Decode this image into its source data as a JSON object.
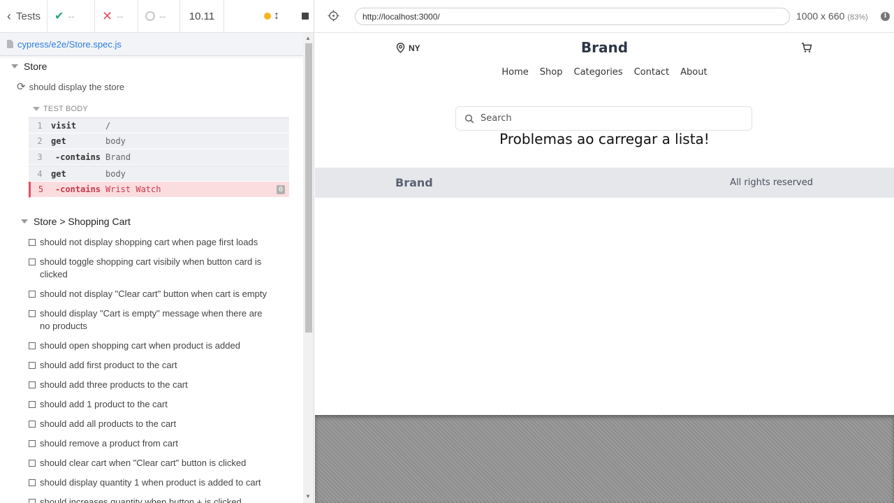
{
  "reporter": {
    "tests_label": "Tests",
    "passed": "--",
    "failed": "--",
    "pending": "--",
    "duration": "10.11",
    "spec_path": "cypress/e2e/Store.spec.js"
  },
  "suite": {
    "title": "Store",
    "test_title": "should display the store",
    "test_body_label": "TEST BODY",
    "commands": [
      {
        "num": "1",
        "name": "visit",
        "message": "/"
      },
      {
        "num": "2",
        "name": "get",
        "message": "body"
      },
      {
        "num": "3",
        "name": "-contains",
        "message": "Brand"
      },
      {
        "num": "4",
        "name": "get",
        "message": "body"
      },
      {
        "num": "5",
        "name": "-contains",
        "message": "Wrist Watch",
        "badge": "0"
      }
    ]
  },
  "cart_suite": {
    "title": "Store > Shopping Cart",
    "tests": [
      "should not display shopping cart when page first loads",
      "should toggle shopping cart visibily when button card is clicked",
      "should not display \"Clear cart\" button when cart is empty",
      "should display \"Cart is empty\" message when there are no products",
      "should open shopping cart when product is added",
      "should add first product to the cart",
      "should add three products to the cart",
      "should add 1 product to the cart",
      "should add all products to the cart",
      "should remove a product from cart",
      "should clear cart when \"Clear cart\" button is clicked",
      "should display quantity 1 when product is added to cart",
      "should increases quantity when button + is clicked"
    ]
  },
  "aut": {
    "url": "http://localhost:3000/",
    "viewport": "1000 x 660",
    "scale": "(83%)"
  },
  "app": {
    "location": "NY",
    "brand": "Brand",
    "nav": [
      "Home",
      "Shop",
      "Categories",
      "Contact",
      "About"
    ],
    "search_placeholder": "Search",
    "error_message": "Problemas ao carregar a lista!",
    "footer_brand": "Brand",
    "footer_rights": "All rights reserved"
  },
  "colors": {
    "pass": "#1fa971",
    "fail": "#e94f5f",
    "link": "#2b7de1",
    "running": "#f7b51b"
  }
}
